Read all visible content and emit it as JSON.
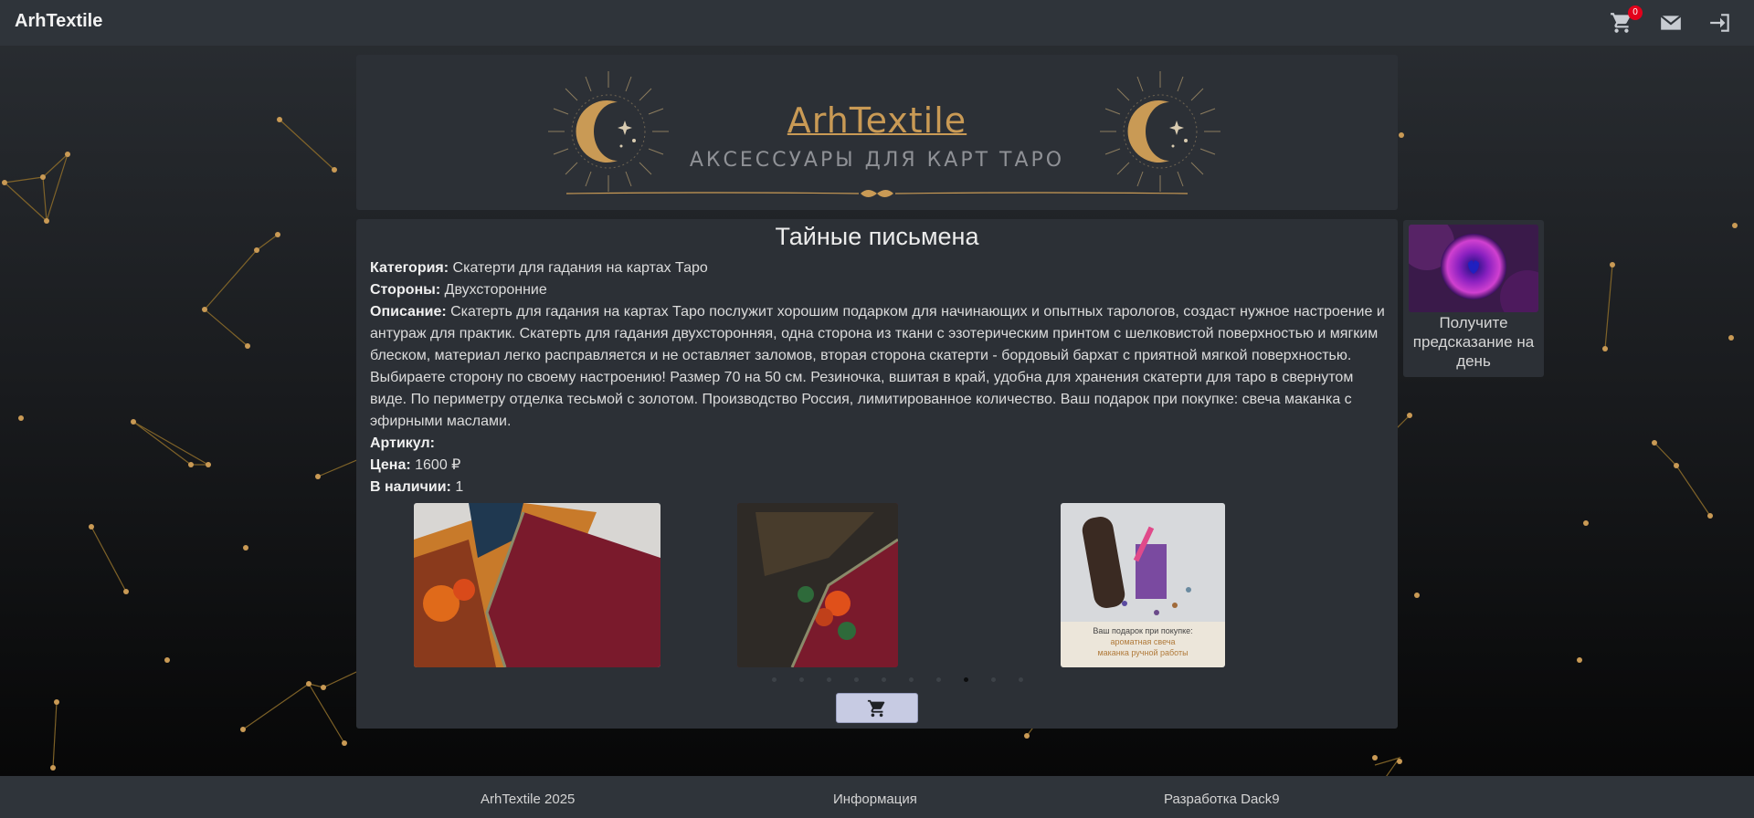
{
  "navbar": {
    "brand": "ArhTextile",
    "cart_count": "0",
    "icons": [
      "cart-icon",
      "mail-icon",
      "login-icon"
    ]
  },
  "banner": {
    "title": "ArhTextile",
    "subtitle": "АКСЕССУАРЫ ДЛЯ КАРТ ТАРО"
  },
  "product": {
    "title": "Тайные письмена",
    "category_label": "Категория:",
    "category": "Скатерти для гадания на картах Таро",
    "sides_label": "Стороны:",
    "sides": "Двухсторонние",
    "description_label": "Описание:",
    "description": "Скатерть для гадания на картах Таро послужит хорошим подарком для начинающих и опытных тарологов, создаст нужное настроение и антураж для практик. Скатерть для гадания двухсторонняя, одна сторона из ткани с эзотерическим принтом с шелковистой поверхностью и мягким блеском, материал легко расправляется и не оставляет заломов, вторая сторона скатерти - бордовый бархат с приятной мягкой поверхностью. Выбираете сторону по своему настроению! Размер 70 на 50 см. Резиночка, вшитая в край, удобна для хранения скатерти для таро в свернутом виде. По периметру отделка тесьмой с золотом. Производство Россия, лимитированное количество. Ваш подарок при покупке: свеча маканка с эфирными маслами.",
    "sku_label": "Артикул:",
    "sku": "",
    "price_label": "Цена:",
    "price": "1600 ₽",
    "stock_label": "В наличии:",
    "stock": "1",
    "gift_caption_line1": "Ваш подарок при покупке:",
    "gift_caption_line2": "ароматная свеча",
    "gift_caption_line3": "маканка ручной работы",
    "carousel_slide_count": 10,
    "carousel_active_index": 7
  },
  "sidebar": {
    "predict_text": "Получите предсказание на день"
  },
  "footer": {
    "copyright": "ArhTextile 2025",
    "info": "Информация",
    "dev": "Разработка Dack9"
  },
  "colors": {
    "accent_gold": "#c99a55",
    "panel": "#2c3036",
    "navbar": "#2f343a",
    "badge": "#e3001b",
    "cart_button": "#c7cbe3"
  }
}
